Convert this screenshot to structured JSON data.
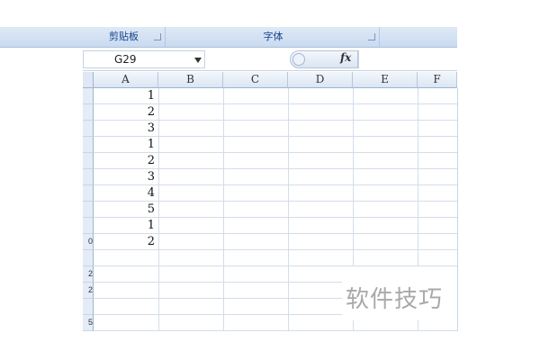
{
  "ribbon": {
    "groups": [
      {
        "label": "剪贴板"
      },
      {
        "label": "字体"
      },
      {
        "label": ""
      }
    ]
  },
  "formula_bar": {
    "name_box": "G29",
    "fx_label": "fx",
    "content": ""
  },
  "grid": {
    "columns": [
      "A",
      "B",
      "C",
      "D",
      "E",
      "F"
    ],
    "row_labels": [
      "",
      "",
      "",
      "",
      "",
      "",
      "",
      "",
      "",
      "0",
      "",
      "2",
      "2",
      "",
      "5"
    ],
    "column_a_values": [
      "1",
      "2",
      "3",
      "1",
      "2",
      "3",
      "4",
      "5",
      "1",
      "2",
      "",
      "",
      "",
      "",
      ""
    ]
  },
  "watermark": "软件技巧"
}
